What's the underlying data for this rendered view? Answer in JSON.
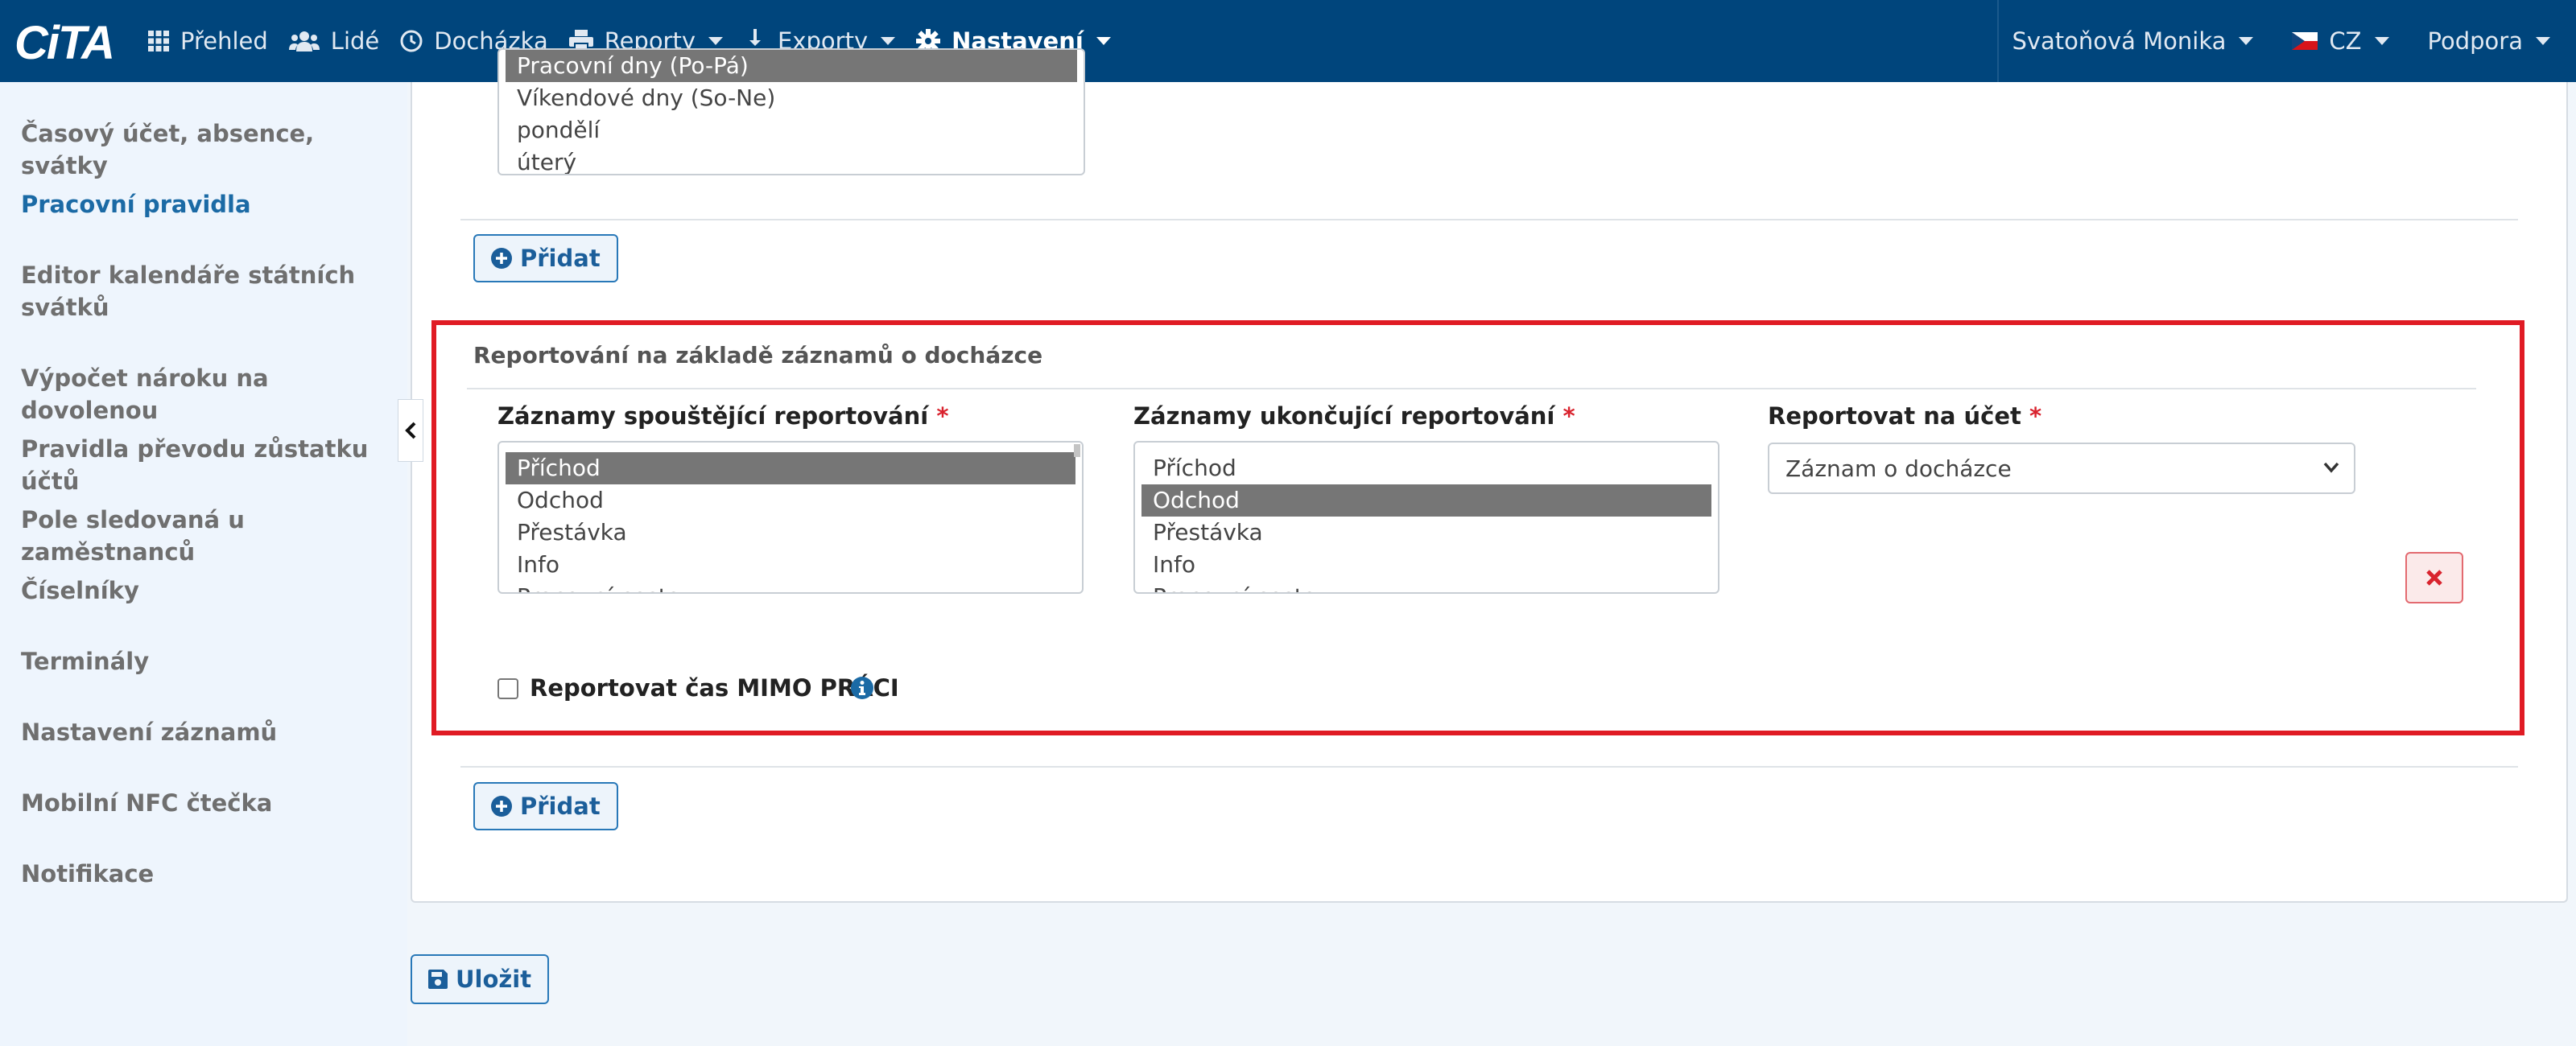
{
  "app": {
    "logo": "CiTA"
  },
  "nav": {
    "items": [
      {
        "label": "Přehled",
        "icon": "grid-icon"
      },
      {
        "label": "Lidé",
        "icon": "users-icon"
      },
      {
        "label": "Docházka",
        "icon": "clock-icon"
      },
      {
        "label": "Reporty",
        "icon": "printer-icon"
      },
      {
        "label": "Exporty",
        "icon": "export-icon"
      },
      {
        "label": "Nastavení",
        "icon": "gear-icon"
      }
    ],
    "user": "Svatoňová Monika",
    "language": "CZ",
    "support": "Podpora"
  },
  "sidebar": {
    "items": [
      {
        "label": "Časový účet, absence, svátky"
      },
      {
        "label": "Pracovní pravidla"
      },
      {
        "label": "Editor kalendáře státních svátků"
      },
      {
        "label": "Výpočet nároku na dovolenou"
      },
      {
        "label": "Pravidla převodu zůstatku účtů"
      },
      {
        "label": "Pole sledovaná u zaměstnanců"
      },
      {
        "label": "Číselníky"
      },
      {
        "label": "Terminály"
      },
      {
        "label": "Nastavení záznamů"
      },
      {
        "label": "Mobilní NFC čtečka"
      },
      {
        "label": "Notifikace"
      }
    ]
  },
  "top_section": {
    "days_options": [
      "Pracovní dny (Po-Pá)",
      "Víkendové dny (So-Ne)",
      "pondělí",
      "úterý"
    ],
    "add_label": "Přidat"
  },
  "reporting": {
    "title": "Reportování na základě záznamů o docházce",
    "start_label": "Záznamy spouštějící reportování",
    "end_label": "Záznamy ukončující reportování",
    "account_label": "Reportovat na účet",
    "required_mark": "*",
    "start_options": [
      "Příchod",
      "Odchod",
      "Přestávka",
      "Info",
      "Pracovní cesta"
    ],
    "end_options": [
      "Příchod",
      "Odchod",
      "Přestávka",
      "Info",
      "Pracovní cesta"
    ],
    "account_value": "Záznam o docházce",
    "checkbox_label": "Reportovat čas MIMO PRÁCI",
    "checkbox_checked": false,
    "add_label": "Přidat"
  },
  "footer": {
    "save_label": "Uložit"
  }
}
